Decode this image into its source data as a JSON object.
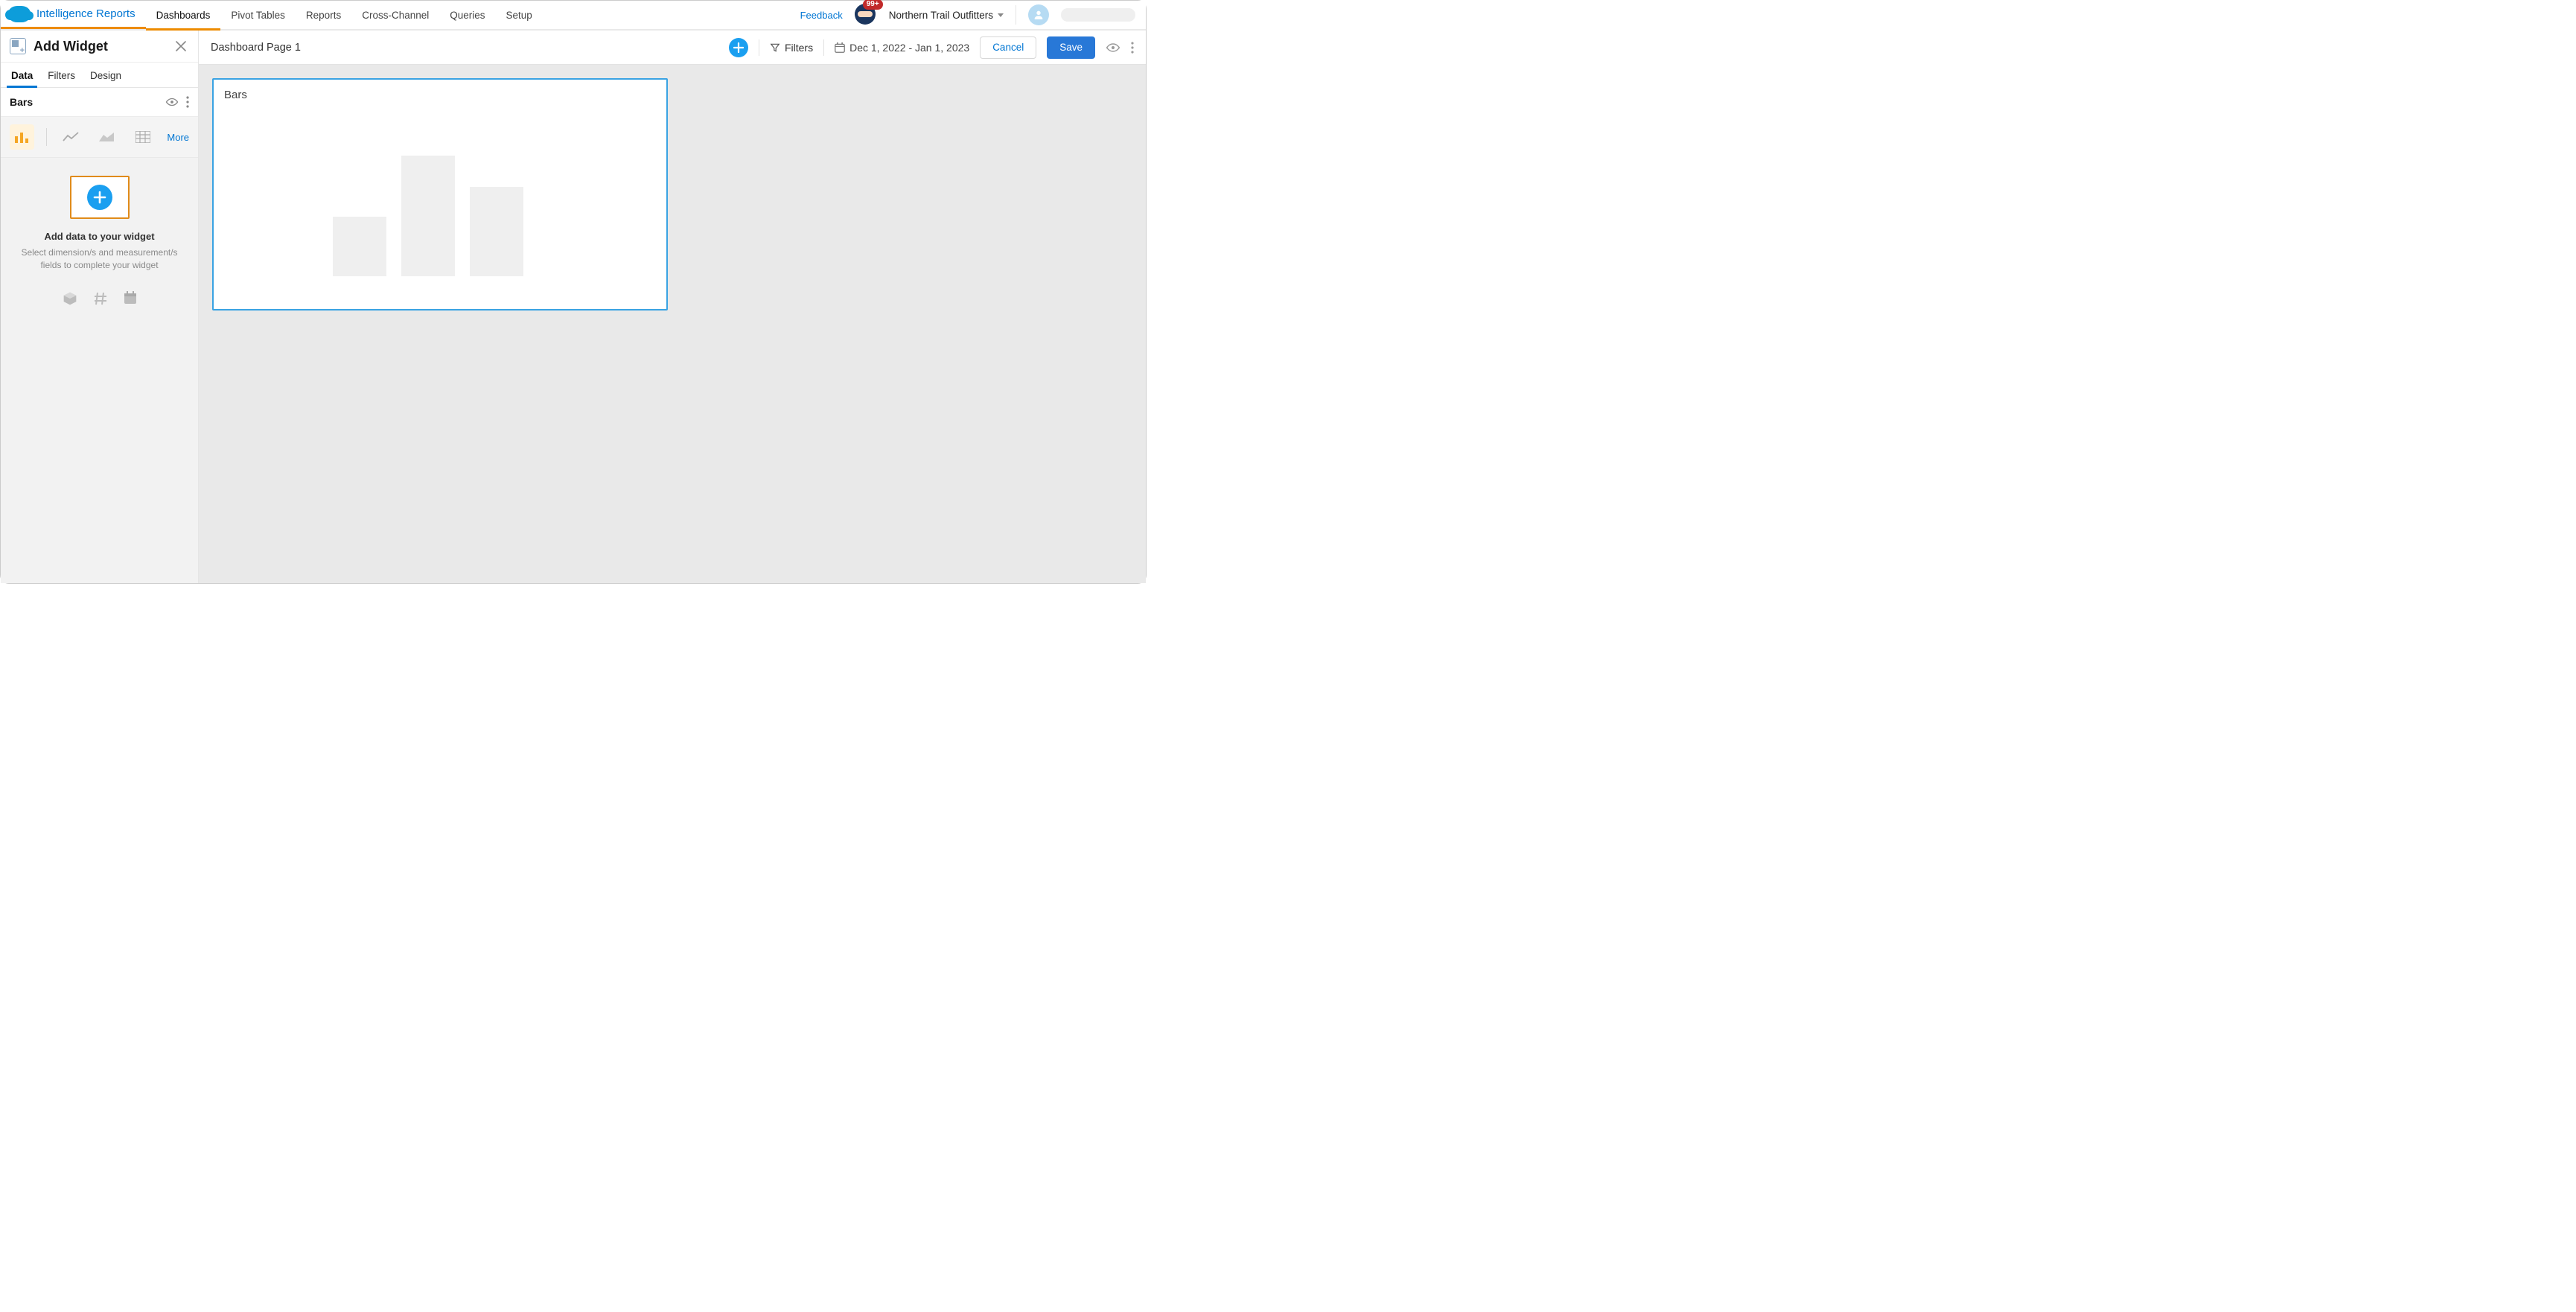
{
  "app_name": "Intelligence Reports",
  "nav_tabs": {
    "dashboards": "Dashboards",
    "pivot_tables": "Pivot Tables",
    "reports": "Reports",
    "cross_channel": "Cross-Channel",
    "queries": "Queries",
    "setup": "Setup"
  },
  "top_right": {
    "feedback": "Feedback",
    "notification_count": "99+",
    "workspace_name": "Northern Trail Outfitters"
  },
  "sidebar": {
    "title": "Add Widget",
    "tabs": {
      "data": "Data",
      "filters": "Filters",
      "design": "Design"
    },
    "widget_name": "Bars",
    "chart_types_more": "More",
    "add_data": {
      "title": "Add data to your widget",
      "subtitle": "Select dimension/s and measurement/s fields to complete your widget"
    }
  },
  "toolbar": {
    "page_title": "Dashboard Page 1",
    "filters_label": "Filters",
    "date_range": "Dec 1, 2022 - Jan 1, 2023",
    "cancel": "Cancel",
    "save": "Save"
  },
  "widget": {
    "title": "Bars"
  }
}
